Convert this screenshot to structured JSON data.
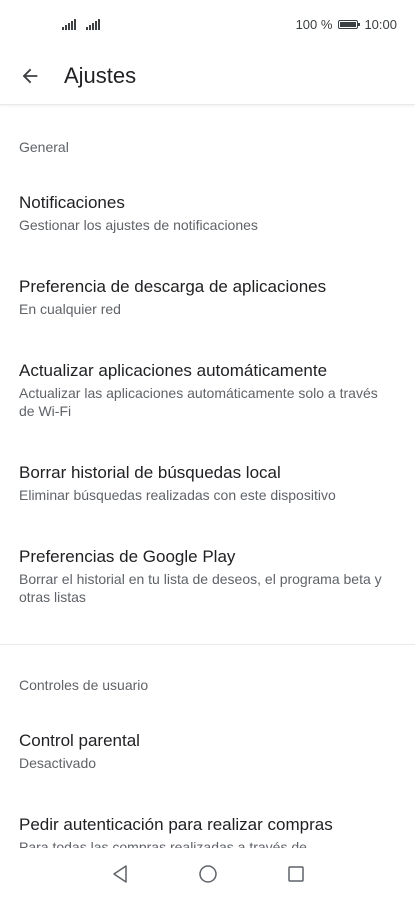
{
  "status_bar": {
    "battery": "100 %",
    "time": "10:00"
  },
  "app_bar": {
    "title": "Ajustes"
  },
  "sections": {
    "general": {
      "header": "General",
      "items": [
        {
          "title": "Notificaciones",
          "subtitle": "Gestionar los ajustes de notificaciones"
        },
        {
          "title": "Preferencia de descarga de aplicaciones",
          "subtitle": "En cualquier red"
        },
        {
          "title": "Actualizar aplicaciones automáticamente",
          "subtitle": "Actualizar las aplicaciones automáticamente solo a través de Wi-Fi"
        },
        {
          "title": "Borrar historial de búsquedas local",
          "subtitle": "Eliminar búsquedas realizadas con este dispositivo"
        },
        {
          "title": "Preferencias de Google Play",
          "subtitle": "Borrar el historial en tu lista de deseos, el programa beta y otras listas"
        }
      ]
    },
    "user_controls": {
      "header": "Controles de usuario",
      "items": [
        {
          "title": "Control parental",
          "subtitle": "Desactivado"
        },
        {
          "title": "Pedir autenticación para realizar compras",
          "subtitle": "Para todas las compras realizadas a través de"
        }
      ]
    }
  },
  "colors": {
    "text_primary": "#202124",
    "text_secondary": "#5f6368",
    "divider": "#e8eaed"
  }
}
